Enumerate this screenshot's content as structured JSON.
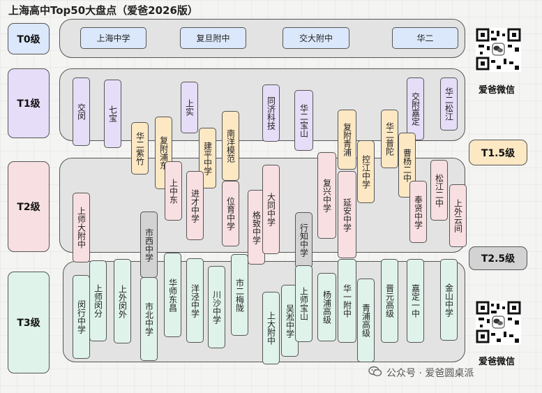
{
  "title": "上海高中Top50大盘点（爱爸2026版）",
  "tiers": {
    "t0": "T0级",
    "t1": "T1级",
    "t15": "T1.5级",
    "t2": "T2级",
    "t25": "T2.5级",
    "t3": "T3级"
  },
  "t0_schools": [
    "上海中学",
    "复旦附中",
    "交大附中",
    "华二"
  ],
  "schools": {
    "jiaomin": "交闵",
    "qibao": "七宝",
    "shangshi": "上实",
    "tongji": "同济科技",
    "huaer_baoshan": "华二宝山",
    "jiaofu_jiading": "交附嘉定",
    "huaer_songjiang": "华二松江",
    "huaer_zizhu": "华二紫竹",
    "fufu_pudong": "复附浦东",
    "jianping": "建平中学",
    "nanyang": "南洋模范",
    "fufu_qingpu": "复附青浦",
    "kongjiang": "控江中学",
    "huaer_putuo": "华二普陀",
    "caoyang": "曹杨二中",
    "shangshida": "上师大附中",
    "shangzhongdong": "上中东",
    "jincai": "进才中学",
    "weiyu": "位育中学",
    "gezhi": "格致中学",
    "datong": "大同中学",
    "fuxing": "复兴中学",
    "yanan": "延安中学",
    "fengxian": "奉贤中学",
    "songjiang_er": "松江二中",
    "shangwai_yunjian": "上外云间",
    "shixi": "市西中学",
    "xingzhi": "行知中学",
    "minhang": "闵行中学",
    "shangshi_minfen": "上师闵分",
    "shangwai_minwai": "上外闵外",
    "shibei": "市北中学",
    "huashi_dongchang": "华师东昌",
    "yangjing": "洋泾中学",
    "chuansha": "川沙中学",
    "shier_meilong": "市二梅陇",
    "shangda": "上大附中",
    "wusong": "吴淞中学",
    "shangshi_baoshan": "上师宝山",
    "yangpu": "杨浦高级",
    "huayi": "华一附中",
    "qingpu": "青浦高级",
    "jinyuan": "晋元高级",
    "jiading_yi": "嘉定一中",
    "jinshan": "金山中学"
  },
  "brand": {
    "top": "爱爸微信",
    "bottom": "爱爸微信"
  },
  "watermark": "公众号 · 爱爸圆桌派",
  "colors": {
    "t0": "#dbe8fb",
    "t1": "#e6ddf8",
    "t15": "#fde8c4",
    "t2": "#f8dfe2",
    "t25": "#d3d3d3",
    "t3": "#dff3ea"
  },
  "icons": {
    "qr": "qr-code-icon",
    "wechat": "wechat-icon"
  }
}
